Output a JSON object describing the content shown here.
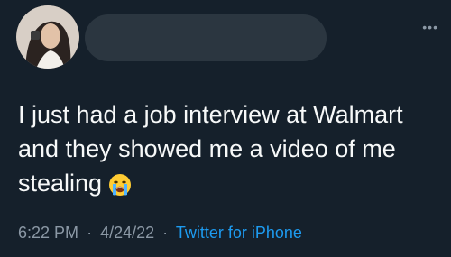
{
  "tweet": {
    "text": "I just had a job interview at Walmart\nand they showed me a video of me\nstealing",
    "emoji": "loudly-crying-face",
    "timestamp": "6:22 PM",
    "date": "4/24/22",
    "separator": "·",
    "source": "Twitter for iPhone"
  },
  "colors": {
    "background": "#15202b",
    "text": "#f7f9f9",
    "muted": "#8b98a5",
    "link": "#1d9bf0"
  },
  "icons": {
    "more": "more-options-icon"
  }
}
